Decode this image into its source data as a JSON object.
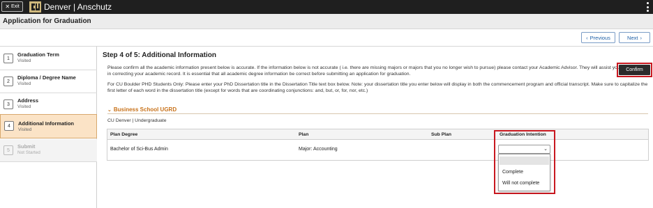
{
  "topbar": {
    "exit_label": "Exit",
    "brand": "Denver | Anschutz",
    "logo_icon": "cu-logo-icon",
    "menu_icon": "kebab-menu-icon"
  },
  "page": {
    "title": "Application for Graduation"
  },
  "nav": {
    "previous_label": "Previous",
    "next_label": "Next"
  },
  "steps": [
    {
      "num": "1",
      "title": "Graduation Term",
      "status": "Visited"
    },
    {
      "num": "2",
      "title": "Diploma / Degree Name",
      "status": "Visited"
    },
    {
      "num": "3",
      "title": "Address",
      "status": "Visited"
    },
    {
      "num": "4",
      "title": "Additional Information",
      "status": "Visited"
    },
    {
      "num": "5",
      "title": "Submit",
      "status": "Not Started"
    }
  ],
  "main": {
    "heading": "Step 4 of 5: Additional Information",
    "info1": "Please confirm all the academic information present below is accurate. If the information below is not accurate ( i.e. there are missing majors or majors that you no longer wish to pursue) please contact your Academic Advisor. They will assist you in correcting your academic record.  It is essential that all academic degree information be correct before submitting an application for graduation.",
    "info2": "For CU Boulder PHD Students Only: Please enter your PhD Dissertation title in the Dissertation Title text box below. Note: your dissertation title you enter below will display in both the commencement program and official transcript. Make sure to capitalize the first letter of each word in the dissertation title (except for words that are coordinating conjunctions: and, but, or, for, nor, etc.)",
    "confirm_label": "Confirm",
    "section_title": "Business School UGRD",
    "program": "CU Denver | Undergraduate",
    "table": {
      "headers": [
        "Plan Degree",
        "Plan",
        "Sub Plan",
        "Graduation Intention"
      ],
      "row": [
        "Bachelor of Sci-Bus Admin",
        "Major: Accounting",
        "",
        ""
      ]
    },
    "graduation_intention": {
      "selected": "",
      "options": [
        "",
        "Complete",
        "Will not complete"
      ]
    }
  },
  "colors": {
    "topbar": "#1f1f1f",
    "accent_orange": "#c8721a",
    "highlight_red": "#c8171f",
    "active_step": "#fbe3c6",
    "link_blue": "#1d5fa6"
  }
}
